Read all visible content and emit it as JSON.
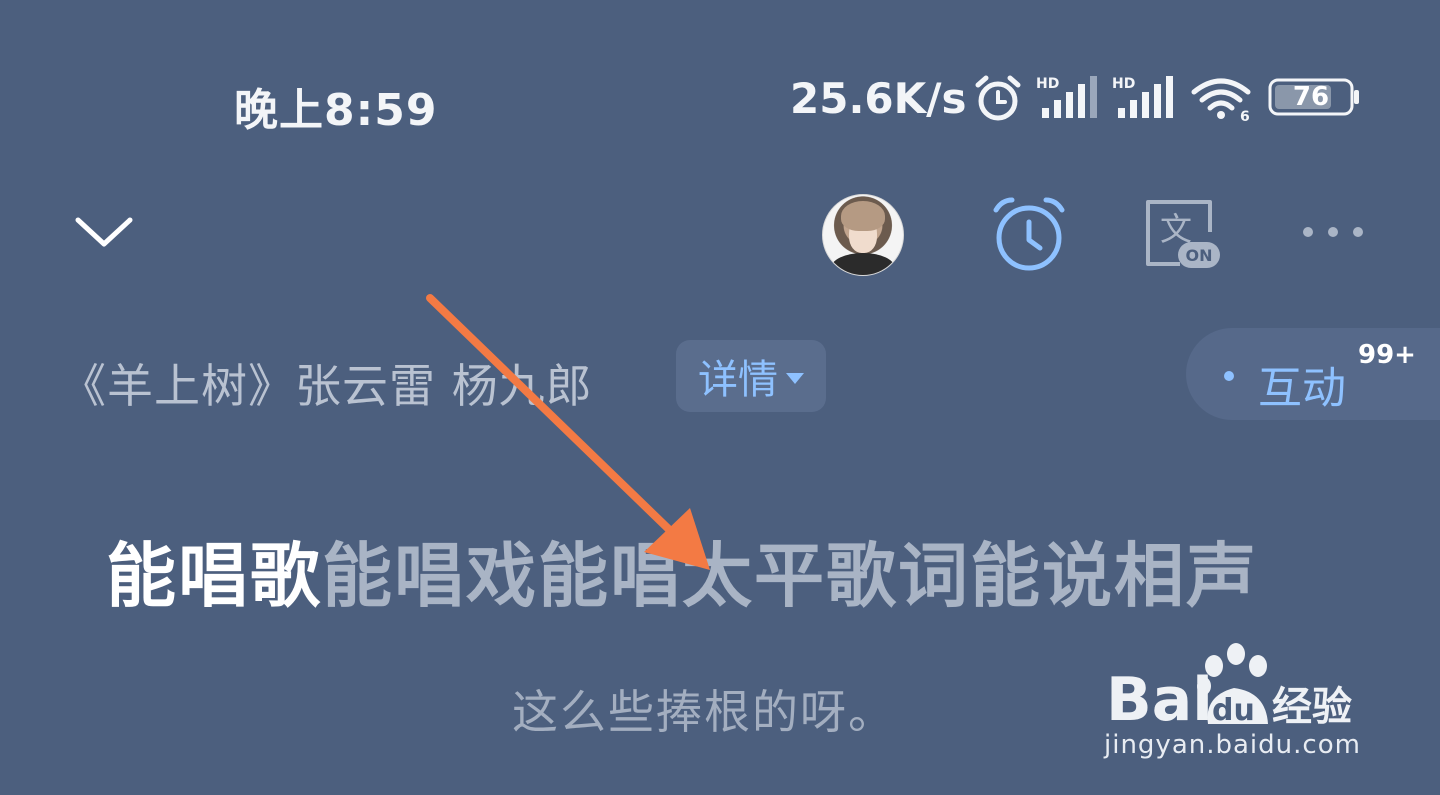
{
  "status_bar": {
    "time": "晚上8:59",
    "net_speed": "25.6K/s",
    "signal_label_1": "HD",
    "signal_label_2": "HD",
    "wifi_label": "6",
    "battery": "76"
  },
  "toolbar": {
    "translate_badge": "ON",
    "translate_char": "文"
  },
  "song": {
    "title": "《羊上树》张云雷 杨九郎",
    "details_label": "详情",
    "interact_label": "互动",
    "interact_count": "99+"
  },
  "lyrics": {
    "current_sung": "能唱歌",
    "current_rest": "能唱戏能唱太平歌词能说相声",
    "next": "这么些捧根的呀。"
  },
  "watermark": {
    "brand": "Bai",
    "brand_du": "du",
    "brand_cn": "经验",
    "url": "jingyan.baidu.com"
  },
  "colors": {
    "background": "#4c5f7e",
    "accent": "#8ec1ff",
    "arrow": "#f37a44"
  }
}
